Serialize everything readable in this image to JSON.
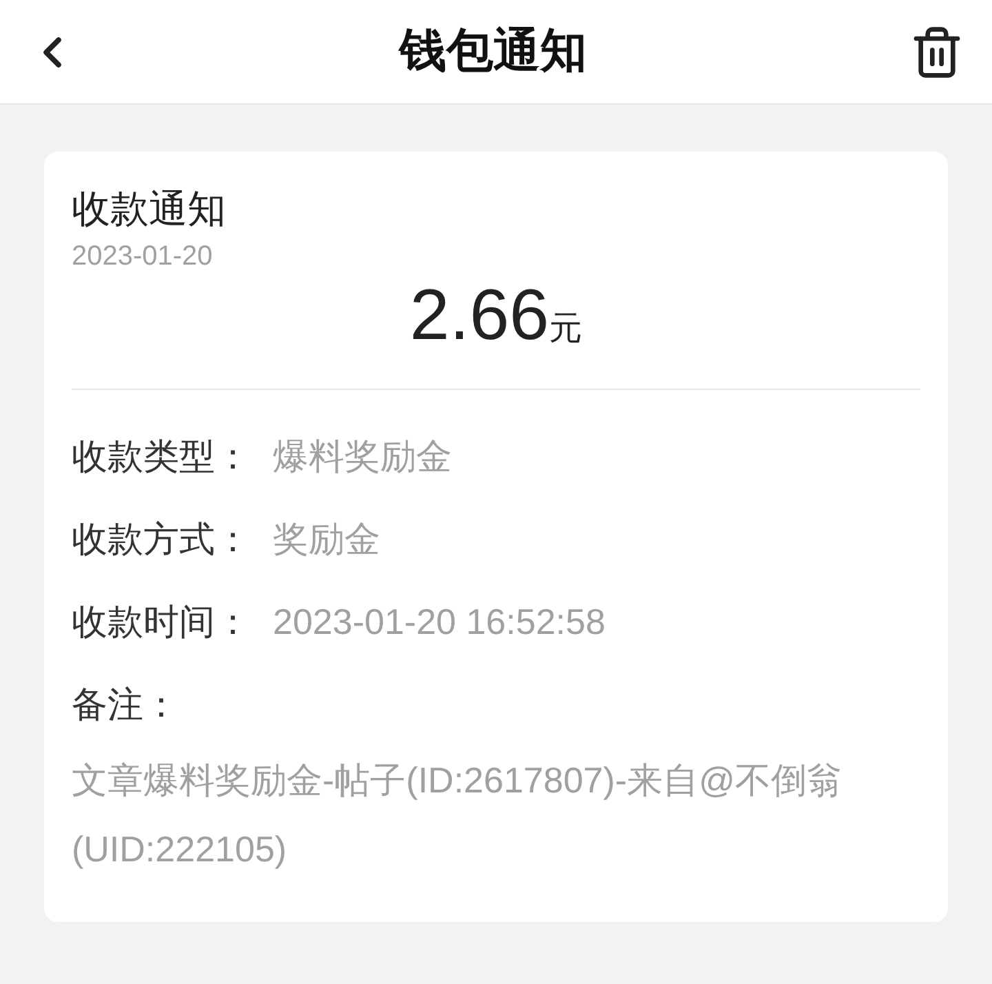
{
  "header": {
    "title": "钱包通知"
  },
  "notice": {
    "title": "收款通知",
    "date": "2023-01-20",
    "amount": "2.66",
    "unit": "元",
    "fields": [
      {
        "label": "收款类型：",
        "value": "爆料奖励金"
      },
      {
        "label": "收款方式：",
        "value": "奖励金"
      },
      {
        "label": "收款时间：",
        "value": "2023-01-20 16:52:58"
      }
    ],
    "remark_label": "备注：",
    "remark": "文章爆料奖励金-帖子(ID:2617807)-来自@不倒翁(UID:222105)"
  }
}
